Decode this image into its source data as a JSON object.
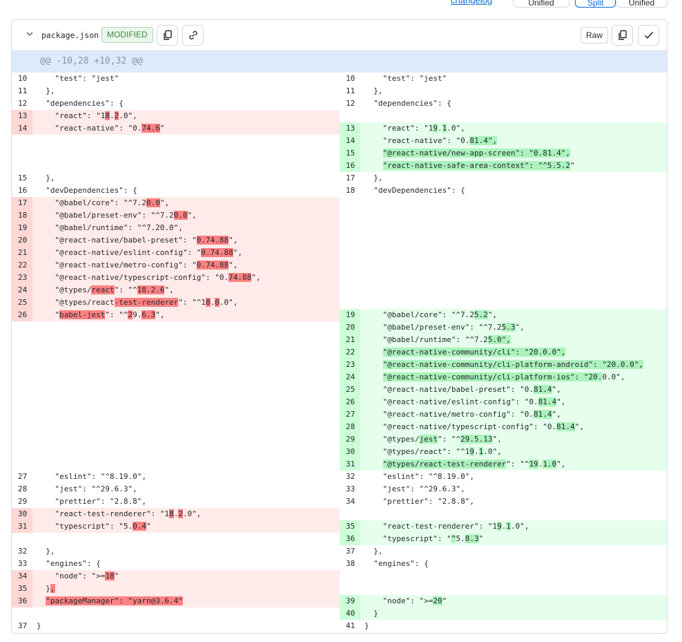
{
  "top": {
    "link_label": "changelog",
    "buttons": [
      "Unified",
      "Split",
      "Unified"
    ]
  },
  "file": {
    "name": "package.json",
    "status": "MODIFIED",
    "raw_label": "Raw"
  },
  "hunk_header": "@@ -10,28 +10,32 @@",
  "left": [
    {
      "n": "10",
      "t": "normal",
      "s": [
        [
          "    \"test\": \"jest\"",
          0
        ]
      ]
    },
    {
      "n": "11",
      "t": "normal",
      "s": [
        [
          "  },",
          0
        ]
      ]
    },
    {
      "n": "12",
      "t": "normal",
      "s": [
        [
          "  \"dependencies\": {",
          0
        ]
      ]
    },
    {
      "n": "13",
      "t": "del",
      "s": [
        [
          "    \"react\": \"1",
          0
        ],
        [
          "8",
          1
        ],
        [
          ".",
          0
        ],
        [
          "2",
          1
        ],
        [
          ".0\",",
          0
        ]
      ]
    },
    {
      "n": "14",
      "t": "del",
      "s": [
        [
          "    \"react-native\": \"0.",
          0
        ],
        [
          "74.6",
          1
        ],
        [
          "\"",
          0
        ]
      ]
    },
    null,
    null,
    null,
    {
      "n": "15",
      "t": "normal",
      "s": [
        [
          "  },",
          0
        ]
      ]
    },
    {
      "n": "16",
      "t": "normal",
      "s": [
        [
          "  \"devDependencies\": {",
          0
        ]
      ]
    },
    {
      "n": "17",
      "t": "del",
      "s": [
        [
          "    \"@babel/core\": \"^7.2",
          0
        ],
        [
          "0.0",
          1
        ],
        [
          "\",",
          0
        ]
      ]
    },
    {
      "n": "18",
      "t": "del",
      "s": [
        [
          "    \"@babel/preset-env\": \"^7.2",
          0
        ],
        [
          "0.0",
          1
        ],
        [
          "\",",
          0
        ]
      ]
    },
    {
      "n": "19",
      "t": "del",
      "s": [
        [
          "    \"@babel/runtime\": \"^7.20.0\",",
          0
        ]
      ]
    },
    {
      "n": "20",
      "t": "del",
      "s": [
        [
          "    \"@react-native/babel-preset\": \"",
          0
        ],
        [
          "0.74.88",
          1
        ],
        [
          "\",",
          0
        ]
      ]
    },
    {
      "n": "21",
      "t": "del",
      "s": [
        [
          "    \"@react-native/eslint-config\": \"",
          0
        ],
        [
          "0.74.88",
          1
        ],
        [
          "\",",
          0
        ]
      ]
    },
    {
      "n": "22",
      "t": "del",
      "s": [
        [
          "    \"@react-native/metro-config\": \"",
          0
        ],
        [
          "0.74.88",
          1
        ],
        [
          "\",",
          0
        ]
      ]
    },
    {
      "n": "23",
      "t": "del",
      "s": [
        [
          "    \"@react-native/typescript-config\": \"0.",
          0
        ],
        [
          "74.88",
          1
        ],
        [
          "\",",
          0
        ]
      ]
    },
    {
      "n": "24",
      "t": "del",
      "s": [
        [
          "    \"@types/",
          0
        ],
        [
          "react",
          1
        ],
        [
          "\": \"^",
          0
        ],
        [
          "18.2.6",
          1
        ],
        [
          "\",",
          0
        ]
      ]
    },
    {
      "n": "25",
      "t": "del",
      "s": [
        [
          "    \"@types/react",
          0
        ],
        [
          "-test-renderer",
          1
        ],
        [
          "\": \"^1",
          0
        ],
        [
          "8",
          1
        ],
        [
          ".",
          0
        ],
        [
          "0",
          1
        ],
        [
          ".0\",",
          0
        ]
      ]
    },
    {
      "n": "26",
      "t": "del",
      "s": [
        [
          "    \"",
          0
        ],
        [
          "babel-jest",
          1
        ],
        [
          "\": \"^",
          0
        ],
        [
          "2",
          1
        ],
        [
          "9.",
          0
        ],
        [
          "6.3",
          1
        ],
        [
          "\",",
          0
        ]
      ]
    },
    null,
    null,
    null,
    null,
    null,
    null,
    null,
    null,
    null,
    null,
    null,
    null,
    {
      "n": "27",
      "t": "normal",
      "s": [
        [
          "    \"eslint\": \"^8.19.0\",",
          0
        ]
      ]
    },
    {
      "n": "28",
      "t": "normal",
      "s": [
        [
          "    \"jest\": \"^29.6.3\",",
          0
        ]
      ]
    },
    {
      "n": "29",
      "t": "normal",
      "s": [
        [
          "    \"prettier\": \"2.8.8\",",
          0
        ]
      ]
    },
    {
      "n": "30",
      "t": "del",
      "s": [
        [
          "    \"react-test-renderer\": \"1",
          0
        ],
        [
          "8",
          1
        ],
        [
          ".",
          0
        ],
        [
          "2",
          1
        ],
        [
          ".0\",",
          0
        ]
      ]
    },
    {
      "n": "31",
      "t": "del",
      "s": [
        [
          "    \"typescript\": \"5.",
          0
        ],
        [
          "0.4",
          1
        ],
        [
          "\"",
          0
        ]
      ]
    },
    null,
    {
      "n": "32",
      "t": "normal",
      "s": [
        [
          "  },",
          0
        ]
      ]
    },
    {
      "n": "33",
      "t": "normal",
      "s": [
        [
          "  \"engines\": {",
          0
        ]
      ]
    },
    {
      "n": "34",
      "t": "del",
      "s": [
        [
          "    \"node\": \">=",
          0
        ],
        [
          "18",
          1
        ],
        [
          "\"",
          0
        ]
      ]
    },
    {
      "n": "35",
      "t": "del",
      "s": [
        [
          "  }",
          0
        ],
        [
          ",",
          1
        ]
      ]
    },
    {
      "n": "36",
      "t": "del",
      "s": [
        [
          "  ",
          0
        ],
        [
          "\"packageManager\": \"yarn@3.6.4\"",
          1
        ]
      ]
    },
    null,
    {
      "n": "37",
      "t": "normal",
      "s": [
        [
          "}",
          0
        ]
      ]
    }
  ],
  "right": [
    {
      "n": "10",
      "t": "normal",
      "s": [
        [
          "    \"test\": \"jest\"",
          0
        ]
      ]
    },
    {
      "n": "11",
      "t": "normal",
      "s": [
        [
          "  },",
          0
        ]
      ]
    },
    {
      "n": "12",
      "t": "normal",
      "s": [
        [
          "  \"dependencies\": {",
          0
        ]
      ]
    },
    null,
    {
      "n": "13",
      "t": "add",
      "s": [
        [
          "    \"react\": \"1",
          0
        ],
        [
          "9",
          1
        ],
        [
          ".",
          0
        ],
        [
          "1",
          1
        ],
        [
          ".0\",",
          0
        ]
      ]
    },
    {
      "n": "14",
      "t": "add",
      "s": [
        [
          "    \"react-native\": \"0.",
          0
        ],
        [
          "81.4\",",
          1
        ]
      ]
    },
    {
      "n": "15",
      "t": "add",
      "s": [
        [
          "    ",
          0
        ],
        [
          "\"@react-native/new-app-screen\": \"0.81.4\",",
          1
        ]
      ]
    },
    {
      "n": "16",
      "t": "add",
      "s": [
        [
          "    ",
          0
        ],
        [
          "\"react-native-safe-area-context\": \"^5.5.2",
          1
        ],
        [
          "\"",
          0
        ]
      ]
    },
    {
      "n": "17",
      "t": "normal",
      "s": [
        [
          "  },",
          0
        ]
      ]
    },
    {
      "n": "18",
      "t": "normal",
      "s": [
        [
          "  \"devDependencies\": {",
          0
        ]
      ]
    },
    null,
    null,
    null,
    null,
    null,
    null,
    null,
    null,
    null,
    {
      "n": "19",
      "t": "add",
      "s": [
        [
          "    \"@babel/core\": \"^7.2",
          0
        ],
        [
          "5.2",
          1
        ],
        [
          "\",",
          0
        ]
      ]
    },
    {
      "n": "20",
      "t": "add",
      "s": [
        [
          "    \"@babel/preset-env\": \"^7.2",
          0
        ],
        [
          "5.3",
          1
        ],
        [
          "\",",
          0
        ]
      ]
    },
    {
      "n": "21",
      "t": "add",
      "s": [
        [
          "    \"@babel/runtime\": \"^7.2",
          0
        ],
        [
          "5.0\",",
          1
        ]
      ]
    },
    {
      "n": "22",
      "t": "add",
      "s": [
        [
          "    ",
          0
        ],
        [
          "\"@react-native-community/cli\": \"20.0.0\",",
          1
        ]
      ]
    },
    {
      "n": "23",
      "t": "add",
      "s": [
        [
          "    ",
          0
        ],
        [
          "\"@react-native-community/cli-platform-android\": \"20.0.0\",",
          1
        ]
      ]
    },
    {
      "n": "24",
      "t": "add",
      "s": [
        [
          "    ",
          0
        ],
        [
          "\"@react-native-community/cli-platform-ios\": \"20.",
          1
        ],
        [
          "0.0\",",
          0
        ]
      ]
    },
    {
      "n": "25",
      "t": "add",
      "s": [
        [
          "    \"@react-native/babel-preset\": \"0.",
          0
        ],
        [
          "81.4",
          1
        ],
        [
          "\",",
          0
        ]
      ]
    },
    {
      "n": "26",
      "t": "add",
      "s": [
        [
          "    \"@react-native/eslint-config\": \"0.",
          0
        ],
        [
          "81.4",
          1
        ],
        [
          "\",",
          0
        ]
      ]
    },
    {
      "n": "27",
      "t": "add",
      "s": [
        [
          "    \"@react-native/metro-config\": \"0.",
          0
        ],
        [
          "81.4",
          1
        ],
        [
          "\",",
          0
        ]
      ]
    },
    {
      "n": "28",
      "t": "add",
      "s": [
        [
          "    \"@react-native/typescript-config\": \"0.",
          0
        ],
        [
          "81.4",
          1
        ],
        [
          "\",",
          0
        ]
      ]
    },
    {
      "n": "29",
      "t": "add",
      "s": [
        [
          "    \"@types/",
          0
        ],
        [
          "jest",
          1
        ],
        [
          "\": \"^",
          0
        ],
        [
          "29.5.13",
          1
        ],
        [
          "\",",
          0
        ]
      ]
    },
    {
      "n": "30",
      "t": "add",
      "s": [
        [
          "    \"@types/react\": \"^1",
          0
        ],
        [
          "9",
          1
        ],
        [
          ".",
          0
        ],
        [
          "1",
          1
        ],
        [
          ".0\",",
          0
        ]
      ]
    },
    {
      "n": "31",
      "t": "add",
      "s": [
        [
          "    ",
          0
        ],
        [
          "\"@types/react-test-renderer",
          1
        ],
        [
          "\": \"^",
          0
        ],
        [
          "19",
          1
        ],
        [
          ".",
          0
        ],
        [
          "1.0",
          1
        ],
        [
          "\",",
          0
        ]
      ]
    },
    {
      "n": "32",
      "t": "normal",
      "s": [
        [
          "    \"eslint\": \"^8.19.0\",",
          0
        ]
      ]
    },
    {
      "n": "33",
      "t": "normal",
      "s": [
        [
          "    \"jest\": \"^29.6.3\",",
          0
        ]
      ]
    },
    {
      "n": "34",
      "t": "normal",
      "s": [
        [
          "    \"prettier\": \"2.8.8\",",
          0
        ]
      ]
    },
    null,
    {
      "n": "35",
      "t": "add",
      "s": [
        [
          "    \"react-test-renderer\": \"1",
          0
        ],
        [
          "9",
          1
        ],
        [
          ".",
          0
        ],
        [
          "1",
          1
        ],
        [
          ".0\",",
          0
        ]
      ]
    },
    {
      "n": "36",
      "t": "add",
      "s": [
        [
          "    \"typescript\": \"",
          0
        ],
        [
          "^",
          1
        ],
        [
          "5.",
          0
        ],
        [
          "8.3",
          1
        ],
        [
          "\"",
          0
        ]
      ]
    },
    {
      "n": "37",
      "t": "normal",
      "s": [
        [
          "  },",
          0
        ]
      ]
    },
    {
      "n": "38",
      "t": "normal",
      "s": [
        [
          "  \"engines\": {",
          0
        ]
      ]
    },
    null,
    null,
    {
      "n": "39",
      "t": "add",
      "s": [
        [
          "    \"node\": \">=",
          0
        ],
        [
          "20",
          1
        ],
        [
          "\"",
          0
        ]
      ]
    },
    {
      "n": "40",
      "t": "add",
      "s": [
        [
          "  }",
          0
        ]
      ]
    },
    {
      "n": "41",
      "t": "normal",
      "s": [
        [
          "}",
          0
        ]
      ]
    }
  ]
}
